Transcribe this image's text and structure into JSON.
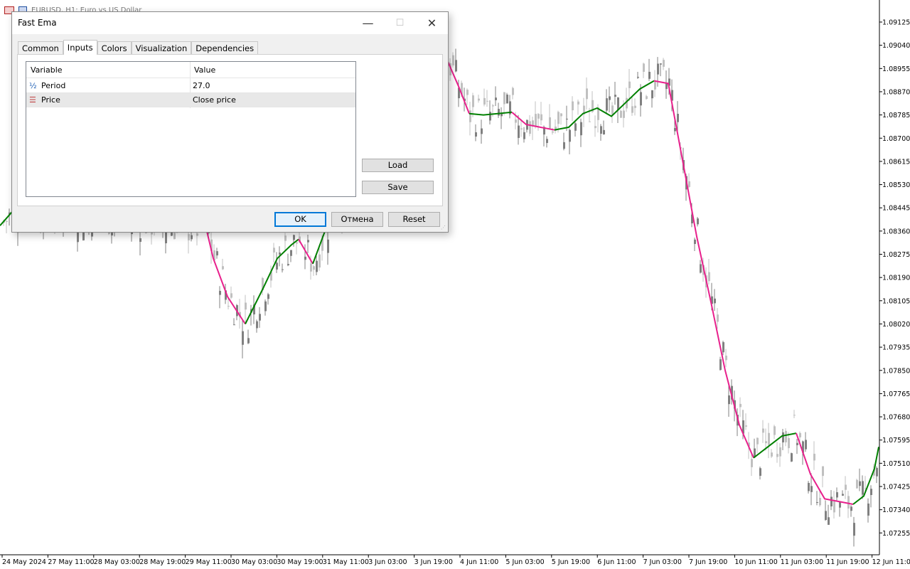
{
  "window": {
    "title": "EURUSD, H1:  Euro vs US Dollar"
  },
  "chart_data": {
    "type": "candlestick",
    "price_labels": [
      "1.09125",
      "1.09040",
      "1.08955",
      "1.08870",
      "1.08785",
      "1.08700",
      "1.08615",
      "1.08530",
      "1.08445",
      "1.08360",
      "1.08275",
      "1.08190",
      "1.08105",
      "1.08020",
      "1.07935",
      "1.07850",
      "1.07765",
      "1.07680",
      "1.07595",
      "1.07510",
      "1.07425",
      "1.07340",
      "1.07255"
    ],
    "time_labels": [
      "24 May 2024",
      "27 May 11:00",
      "28 May 03:00",
      "28 May 19:00",
      "29 May 11:00",
      "30 May 03:00",
      "30 May 19:00",
      "31 May 11:00",
      "3 Jun 03:00",
      "3 Jun 19:00",
      "4 Jun 11:00",
      "5 Jun 03:00",
      "5 Jun 19:00",
      "6 Jun 11:00",
      "7 Jun 03:00",
      "7 Jun 19:00",
      "10 Jun 11:00",
      "11 Jun 03:00",
      "11 Jun 19:00",
      "12 Jun 11:00"
    ],
    "ylim": [
      1.0719,
      1.0921
    ],
    "current_price": "1.08275",
    "colors": {
      "up_trend": "#008000",
      "down_trend": "#e8208c",
      "candle_light": "#c0c0c0",
      "candle_dark": "#808080",
      "axis": "#000000"
    },
    "ema_segments": [
      {
        "trend": "up",
        "points": [
          [
            0,
            1.0838
          ],
          [
            22,
            1.08445
          ]
        ]
      },
      {
        "trend": "down",
        "points": [
          [
            290,
            1.0837
          ],
          [
            300,
            1.0826
          ],
          [
            320,
            1.0812
          ],
          [
            345,
            1.0802
          ]
        ]
      },
      {
        "trend": "up",
        "points": [
          [
            345,
            1.0802
          ],
          [
            370,
            1.0815
          ],
          [
            390,
            1.0826
          ],
          [
            410,
            1.0831
          ],
          [
            420,
            1.0833
          ]
        ]
      },
      {
        "trend": "down",
        "points": [
          [
            420,
            1.0833
          ],
          [
            440,
            1.0824
          ]
        ]
      },
      {
        "trend": "up",
        "points": [
          [
            440,
            1.0824
          ],
          [
            460,
            1.0838
          ]
        ]
      },
      {
        "trend": "down",
        "points": [
          [
            630,
            1.0898
          ],
          [
            645,
            1.0889
          ],
          [
            660,
            1.0879
          ]
        ]
      },
      {
        "trend": "up",
        "points": [
          [
            660,
            1.0879
          ],
          [
            680,
            1.08785
          ],
          [
            700,
            1.0879
          ],
          [
            720,
            1.08795
          ]
        ]
      },
      {
        "trend": "down",
        "points": [
          [
            720,
            1.08795
          ],
          [
            740,
            1.0875
          ],
          [
            760,
            1.0874
          ],
          [
            780,
            1.0873
          ]
        ]
      },
      {
        "trend": "up",
        "points": [
          [
            780,
            1.0873
          ],
          [
            800,
            1.0874
          ],
          [
            820,
            1.0879
          ],
          [
            840,
            1.0881
          ],
          [
            860,
            1.0878
          ],
          [
            880,
            1.0883
          ],
          [
            900,
            1.0888
          ],
          [
            920,
            1.0891
          ]
        ]
      },
      {
        "trend": "down",
        "points": [
          [
            920,
            1.0891
          ],
          [
            940,
            1.089
          ],
          [
            960,
            1.0862
          ],
          [
            980,
            1.0834
          ],
          [
            1000,
            1.081
          ],
          [
            1020,
            1.0785
          ],
          [
            1040,
            1.0765
          ],
          [
            1060,
            1.0753
          ]
        ]
      },
      {
        "trend": "up",
        "points": [
          [
            1060,
            1.0753
          ],
          [
            1080,
            1.0757
          ],
          [
            1100,
            1.0761
          ],
          [
            1120,
            1.0762
          ]
        ]
      },
      {
        "trend": "down",
        "points": [
          [
            1120,
            1.0762
          ],
          [
            1140,
            1.0747
          ],
          [
            1160,
            1.0738
          ],
          [
            1180,
            1.0737
          ],
          [
            1200,
            1.0736
          ]
        ]
      },
      {
        "trend": "up",
        "points": [
          [
            1200,
            1.0736
          ],
          [
            1215,
            1.0739
          ],
          [
            1230,
            1.0749
          ],
          [
            1236,
            1.0757
          ]
        ]
      }
    ]
  },
  "dialog": {
    "title": "Fast Ema",
    "minimize": "—",
    "maximize": "☐",
    "close": "✕",
    "tabs": [
      "Common",
      "Inputs",
      "Colors",
      "Visualization",
      "Dependencies"
    ],
    "active_tab": "Inputs",
    "table": {
      "headers": [
        "Variable",
        "Value"
      ],
      "rows": [
        {
          "icon": "fraction-icon",
          "glyph": "½",
          "variable": "Period",
          "value": "27.0"
        },
        {
          "icon": "list-icon",
          "glyph": "☰",
          "variable": "Price",
          "value": "Close price"
        }
      ]
    },
    "buttons": {
      "load": "Load",
      "save": "Save",
      "ok": "OK",
      "cancel": "Отмена",
      "reset": "Reset"
    }
  }
}
